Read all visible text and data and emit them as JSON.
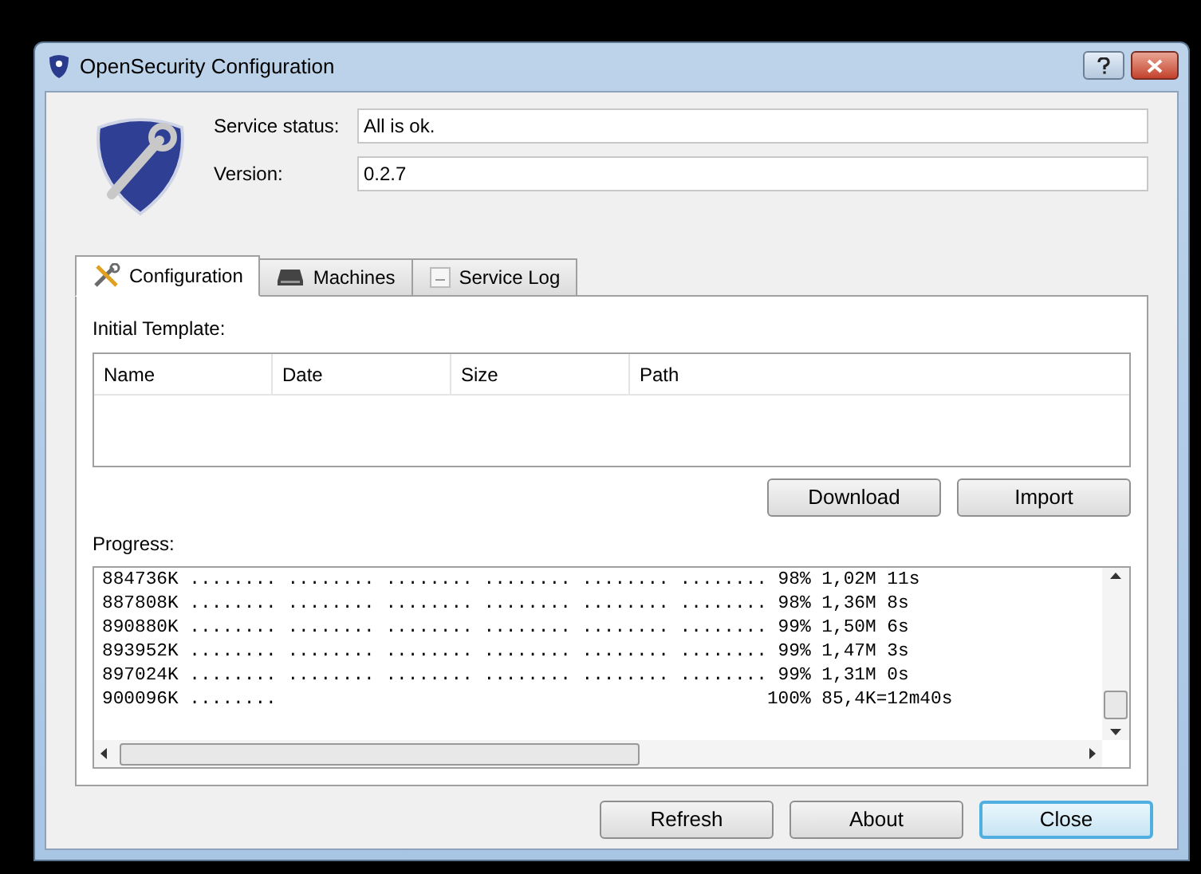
{
  "window": {
    "title": "OpenSecurity Configuration"
  },
  "fields": [
    {
      "label": "Service status:",
      "value": "All is ok."
    },
    {
      "label": "Version:",
      "value": "0.2.7"
    }
  ],
  "tabs": [
    {
      "label": "Configuration",
      "kind": "tools",
      "selected": true
    },
    {
      "label": "Machines",
      "kind": "drive",
      "selected": false
    },
    {
      "label": "Service Log",
      "kind": "log",
      "selected": false
    }
  ],
  "template": {
    "label": "Initial Template:",
    "columns": [
      "Name",
      "Date",
      "Size",
      "Path"
    ],
    "buttons": [
      "Download",
      "Import"
    ]
  },
  "progress": {
    "label": "Progress:",
    "lines": [
      "884736K ........ ........ ........ ........ ........ ........ 98% 1,02M 11s",
      "887808K ........ ........ ........ ........ ........ ........ 98% 1,36M 8s",
      "890880K ........ ........ ........ ........ ........ ........ 99% 1,50M 6s",
      "893952K ........ ........ ........ ........ ........ ........ 99% 1,47M 3s",
      "897024K ........ ........ ........ ........ ........ ........ 99% 1,31M 0s",
      "900096K ........                                             100% 85,4K=12m40s"
    ]
  },
  "footer_buttons": [
    {
      "label": "Refresh",
      "default": false
    },
    {
      "label": "About",
      "default": false
    },
    {
      "label": "Close",
      "default": true
    }
  ]
}
